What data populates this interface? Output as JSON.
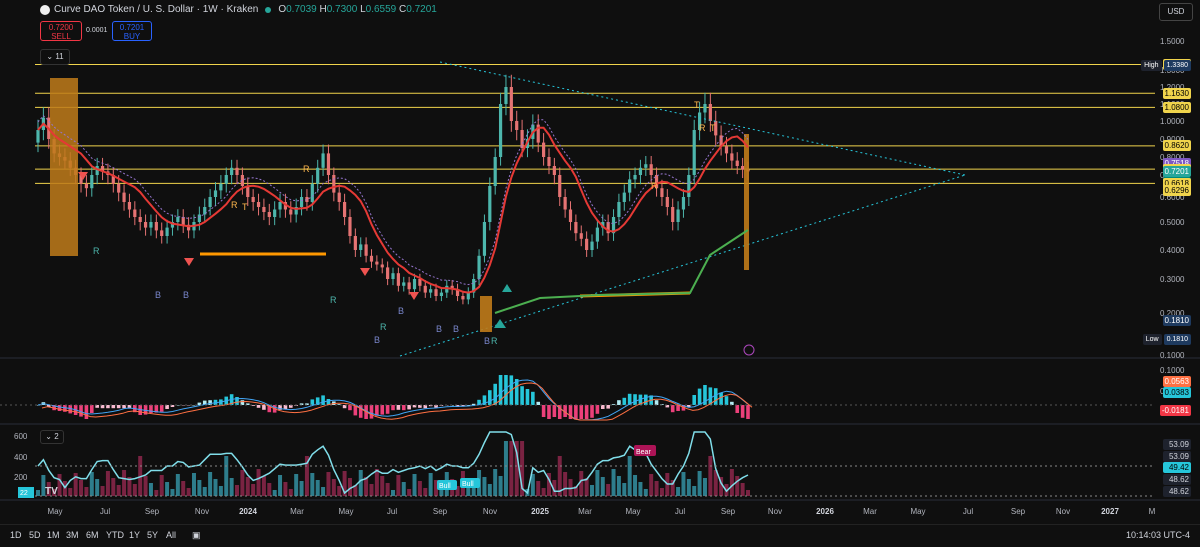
{
  "header": {
    "symbol_title": "Curve DAO Token / U. S. Dollar · 1W · Kraken",
    "o_label": "O",
    "o_value": "0.7039",
    "h_label": "H",
    "h_value": "0.7300",
    "l_label": "L",
    "l_value": "0.6559",
    "c_label": "C",
    "c_value": "0.7201"
  },
  "trade": {
    "sell_price": "0.7200",
    "sell_label": "SELL",
    "spread": "0.0001",
    "buy_price": "0.7201",
    "buy_label": "BUY"
  },
  "indicators_collapse_label": "11",
  "lower_collapse_label": "2",
  "currency_button": "USD",
  "price_axis": [
    "1.5000",
    "1.3000",
    "1.2000",
    "1.1000",
    "1.0000",
    "0.9000",
    "0.8000",
    "0.7000",
    "0.6000",
    "0.5000",
    "0.4000",
    "0.3000",
    "0.2000",
    "0.1000"
  ],
  "price_labels": [
    {
      "text": "1.3380",
      "kind": "yellow"
    },
    {
      "text": "1.1630",
      "kind": "yellow"
    },
    {
      "text": "1.0800",
      "kind": "yellow"
    },
    {
      "text": "0.8620",
      "kind": "yellow"
    },
    {
      "text": "0.7518",
      "kind": "purple"
    },
    {
      "text": "0.7328",
      "kind": "yellow"
    },
    {
      "text": "0.7201",
      "kind": "teal"
    },
    {
      "text": "4d 10h",
      "kind": "teal2"
    },
    {
      "text": "0.6618",
      "kind": "yellow"
    },
    {
      "text": "0.6296",
      "kind": "yellow"
    },
    {
      "text": "0.1810",
      "kind": "dark"
    }
  ],
  "high_tag": {
    "label": "High",
    "value": "1.3380"
  },
  "low_tag": {
    "label": "Low",
    "value": "0.1810"
  },
  "macd_axis": [
    "0.1000",
    "0.0000"
  ],
  "macd_labels": [
    {
      "text": "0.0563",
      "kind": "orange"
    },
    {
      "text": "0.0383",
      "kind": "cyan"
    },
    {
      "text": "-0.0181",
      "kind": "red"
    }
  ],
  "rsi_axis_left": [
    "600",
    "400",
    "200"
  ],
  "rsi_left_badge": "22",
  "rsi_labels": [
    "53.09",
    "53.09",
    "49.42",
    "48.62",
    "48.62"
  ],
  "chart_markers": {
    "R": "R",
    "B": "B",
    "T": "T",
    "Bull": "Bull",
    "Bear": "Bear"
  },
  "time_axis": [
    "May",
    "Jul",
    "Sep",
    "Nov",
    "2024",
    "Mar",
    "May",
    "Jul",
    "Sep",
    "Nov",
    "2025",
    "Mar",
    "May",
    "Jul",
    "Sep",
    "Nov",
    "2026",
    "Mar",
    "May",
    "Jul",
    "Sep",
    "Nov",
    "2027",
    "M"
  ],
  "timeframes": [
    "1D",
    "5D",
    "1M",
    "3M",
    "6M",
    "YTD",
    "1Y",
    "5Y",
    "All"
  ],
  "clock": "10:14:03 UTC-4",
  "colors": {
    "bg": "#0f0f0f",
    "up": "#26a69a",
    "down": "#ef5350",
    "level": "#f0d44c",
    "trend": "#26c6da",
    "ema": "#e53935",
    "accent": "#ffb74d"
  }
}
